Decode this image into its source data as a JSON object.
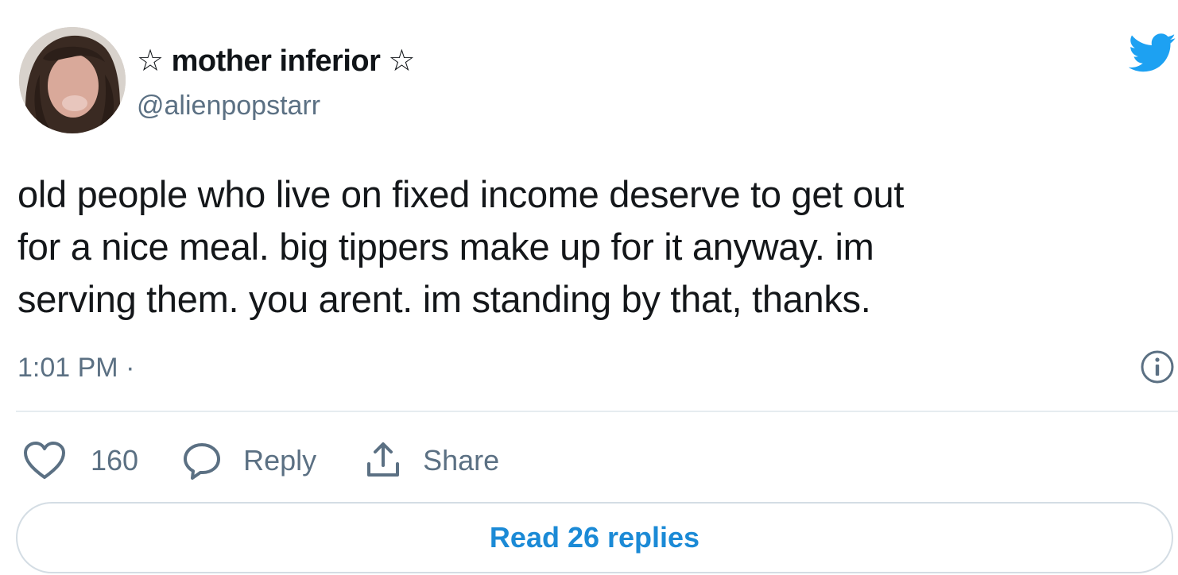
{
  "author": {
    "display_name": "☆ mother inferior ☆",
    "handle": "@alienpopstarr",
    "avatar_icon": "profile-photo"
  },
  "brand": {
    "icon": "twitter-bird-icon",
    "color": "#1da1f2"
  },
  "tweet": {
    "lines": [
      "old people who live on fixed income deserve to get out",
      "for a nice meal. big tippers make up for it anyway. im",
      "serving them. you arent. im standing by that, thanks."
    ],
    "timestamp": "1:01 PM ·"
  },
  "actions": {
    "like_count": "160",
    "reply_label": "Reply",
    "share_label": "Share"
  },
  "footer": {
    "read_replies_label": "Read 26 replies"
  },
  "colors": {
    "text": "#14171a",
    "secondary": "#5b7083",
    "link": "#1b8ad6",
    "divider": "#e6ecf0"
  }
}
